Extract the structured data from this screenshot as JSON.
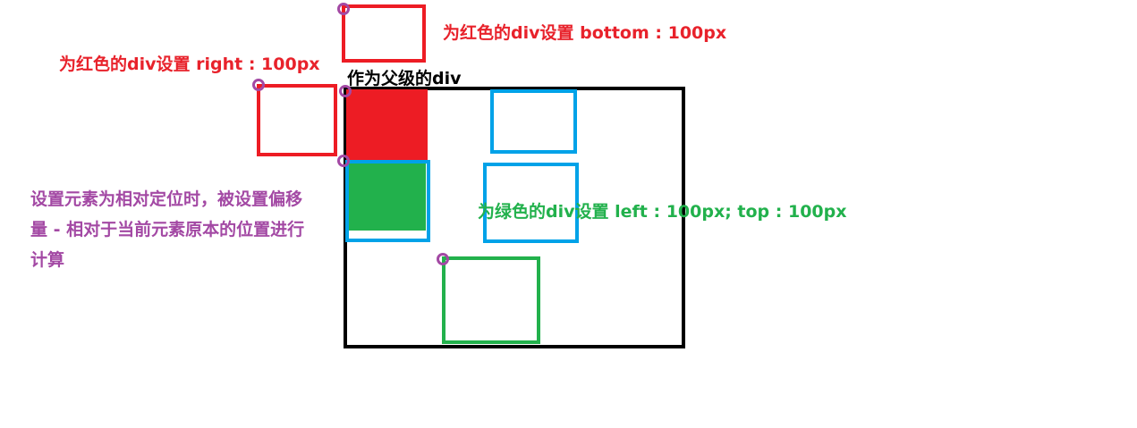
{
  "labels": {
    "red_bottom": "为红色的div设置 bottom : 100px",
    "red_right": "为红色的div设置 right : 100px",
    "parent": "作为父级的div",
    "green_left_top": "为绿色的div设置 left : 100px; top : 100px",
    "relative_note": "设置元素为相对定位时，被设置偏移量 - 相对于当前元素原本的位置进行计算"
  },
  "colors": {
    "red": "#ed1c24",
    "green": "#22b14c",
    "blue": "#00a2e8",
    "purple": "#a349a4",
    "black": "#000000"
  }
}
